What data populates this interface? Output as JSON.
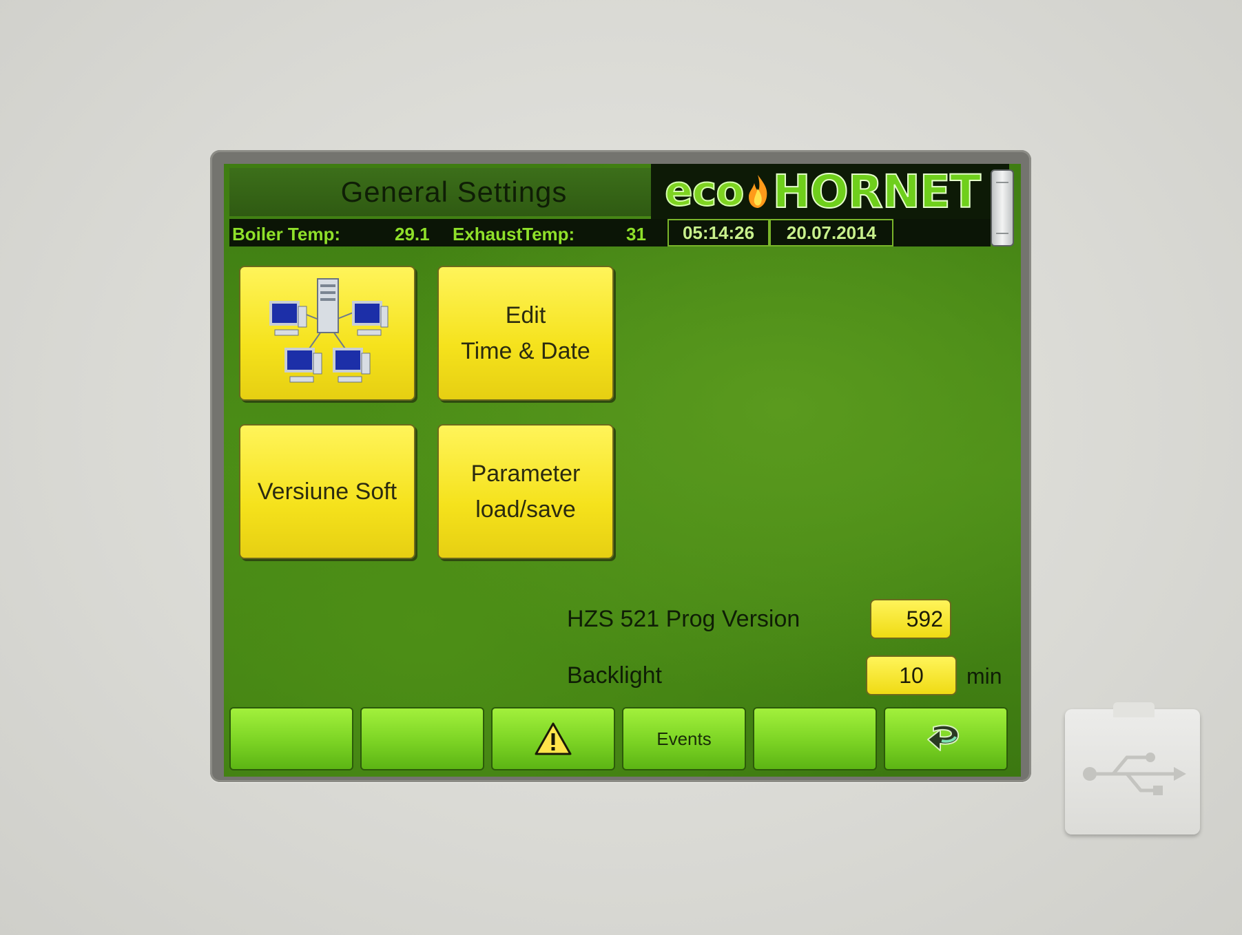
{
  "header": {
    "title": "General Settings",
    "brand_prefix": "eco",
    "brand_name": "HORNET"
  },
  "status": {
    "boiler_label": "Boiler Temp:",
    "boiler_value": "29.1",
    "exhaust_label": "ExhaustTemp:",
    "exhaust_value": "31",
    "time": "05:14:26",
    "date": "20.07.2014"
  },
  "tiles": {
    "network_icon": "network-computers-icon",
    "edit_time_line1": "Edit",
    "edit_time_line2": "Time & Date",
    "version_label": "Versiune Soft",
    "param_line1": "Parameter",
    "param_line2": "load/save"
  },
  "fields": {
    "prog_version_label": "HZS 521 Prog Version",
    "prog_version_value": "592",
    "backlight_label": "Backlight",
    "backlight_value": "10",
    "backlight_unit": "min"
  },
  "softkeys": {
    "warning_icon": "warning-icon",
    "events_label": "Events",
    "back_icon": "back-arrow-icon"
  },
  "colors": {
    "screen_green": "#4a8c17",
    "tile_yellow": "#f5e21c",
    "status_text": "#8fe02a"
  }
}
